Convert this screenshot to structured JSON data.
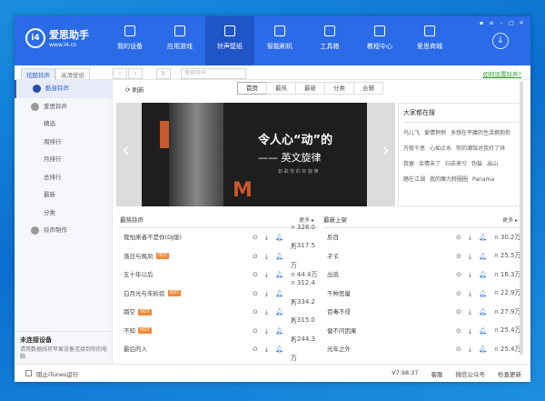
{
  "app": {
    "logo_name": "爱思助手",
    "logo_url": "www.i4.cn",
    "logo_mark": "i4"
  },
  "nav": [
    {
      "label": "我的设备",
      "icon": "phone-icon"
    },
    {
      "label": "应用游戏",
      "icon": "appstore-icon"
    },
    {
      "label": "铃声壁纸",
      "icon": "music-icon",
      "active": true
    },
    {
      "label": "智能刷机",
      "icon": "flash-icon"
    },
    {
      "label": "工具箱",
      "icon": "toolbox-icon"
    },
    {
      "label": "教程中心",
      "icon": "graduation-icon"
    },
    {
      "label": "爱思商城",
      "icon": "shop-icon"
    }
  ],
  "toolbar": {
    "tabs": [
      "炫酷铃声",
      "高清壁纸"
    ],
    "active_tab": 0,
    "search_placeholder": "搜索铃声",
    "help_link": "如何设置铃声?"
  },
  "sidebar": {
    "items": [
      {
        "label": "酷音铃声",
        "active": true
      },
      {
        "label": "爱思铃声"
      },
      {
        "label": "精选"
      },
      {
        "label": "周排行"
      },
      {
        "label": "月排行"
      },
      {
        "label": "总排行"
      },
      {
        "label": "最新"
      },
      {
        "label": "分类"
      },
      {
        "label": "铃声制作"
      }
    ],
    "device_title": "未连接设备",
    "device_desc": "请用数据线将苹果设备连接到你的电脑"
  },
  "main": {
    "refresh": "刷新",
    "tabs": [
      "首页",
      "最热",
      "最新",
      "分类",
      "合辑"
    ],
    "active_tab": 0,
    "banner": {
      "title": "令人心“动”的",
      "subtitle": "—— 英文旋律",
      "small": "如 歌 你 的 好 旋 律",
      "letter": "M"
    },
    "hot_search": {
      "title": "大家都在搜",
      "keywords": [
        "乌儿飞",
        "爱情悄悄",
        "多想在平庸的生活拥抱你",
        "万般千思",
        "心如止水",
        "你的酒馆对我打了烊",
        "我留",
        "余情未了",
        "归去来兮",
        "伪装",
        "出山",
        "踏在江湖",
        "我的魔力转圈圈",
        "Panama"
      ]
    },
    "hot_list": {
      "title": "最热铃声",
      "more": "更多",
      "items": [
        {
          "name": "我怕来者不是你(DJ版)",
          "count": "328.0万",
          "hot": false
        },
        {
          "name": "落日与晚风",
          "count": "317.5万",
          "hot": true
        },
        {
          "name": "五十年以后",
          "count": "44.4万",
          "hot": false
        },
        {
          "name": "白月光与朱砂痣",
          "count": "312.4万",
          "hot": true
        },
        {
          "name": "踏空",
          "count": "334.2万",
          "hot": true
        },
        {
          "name": "不知",
          "count": "315.0万",
          "hot": true
        },
        {
          "name": "最后的人",
          "count": "244.3万",
          "hot": false
        }
      ]
    },
    "new_list": {
      "title": "最新上架",
      "more": "更多",
      "items": [
        {
          "name": "反目",
          "count": "30.2万"
        },
        {
          "name": "孑孓",
          "count": "25.5万"
        },
        {
          "name": "出逃",
          "count": "16.3万"
        },
        {
          "name": "千种思量",
          "count": "22.9万"
        },
        {
          "name": "百毒不侵",
          "count": "27.9万"
        },
        {
          "name": "偏不问因果",
          "count": "25.4万"
        },
        {
          "name": "光年之外",
          "count": "25.4万"
        }
      ]
    },
    "hot_badge": "HOT"
  },
  "footer": {
    "block_itunes": "阻止iTunes运行",
    "version": "V7.98.37",
    "feedback": "客服",
    "wechat": "微信公众号",
    "update": "检查更新"
  }
}
